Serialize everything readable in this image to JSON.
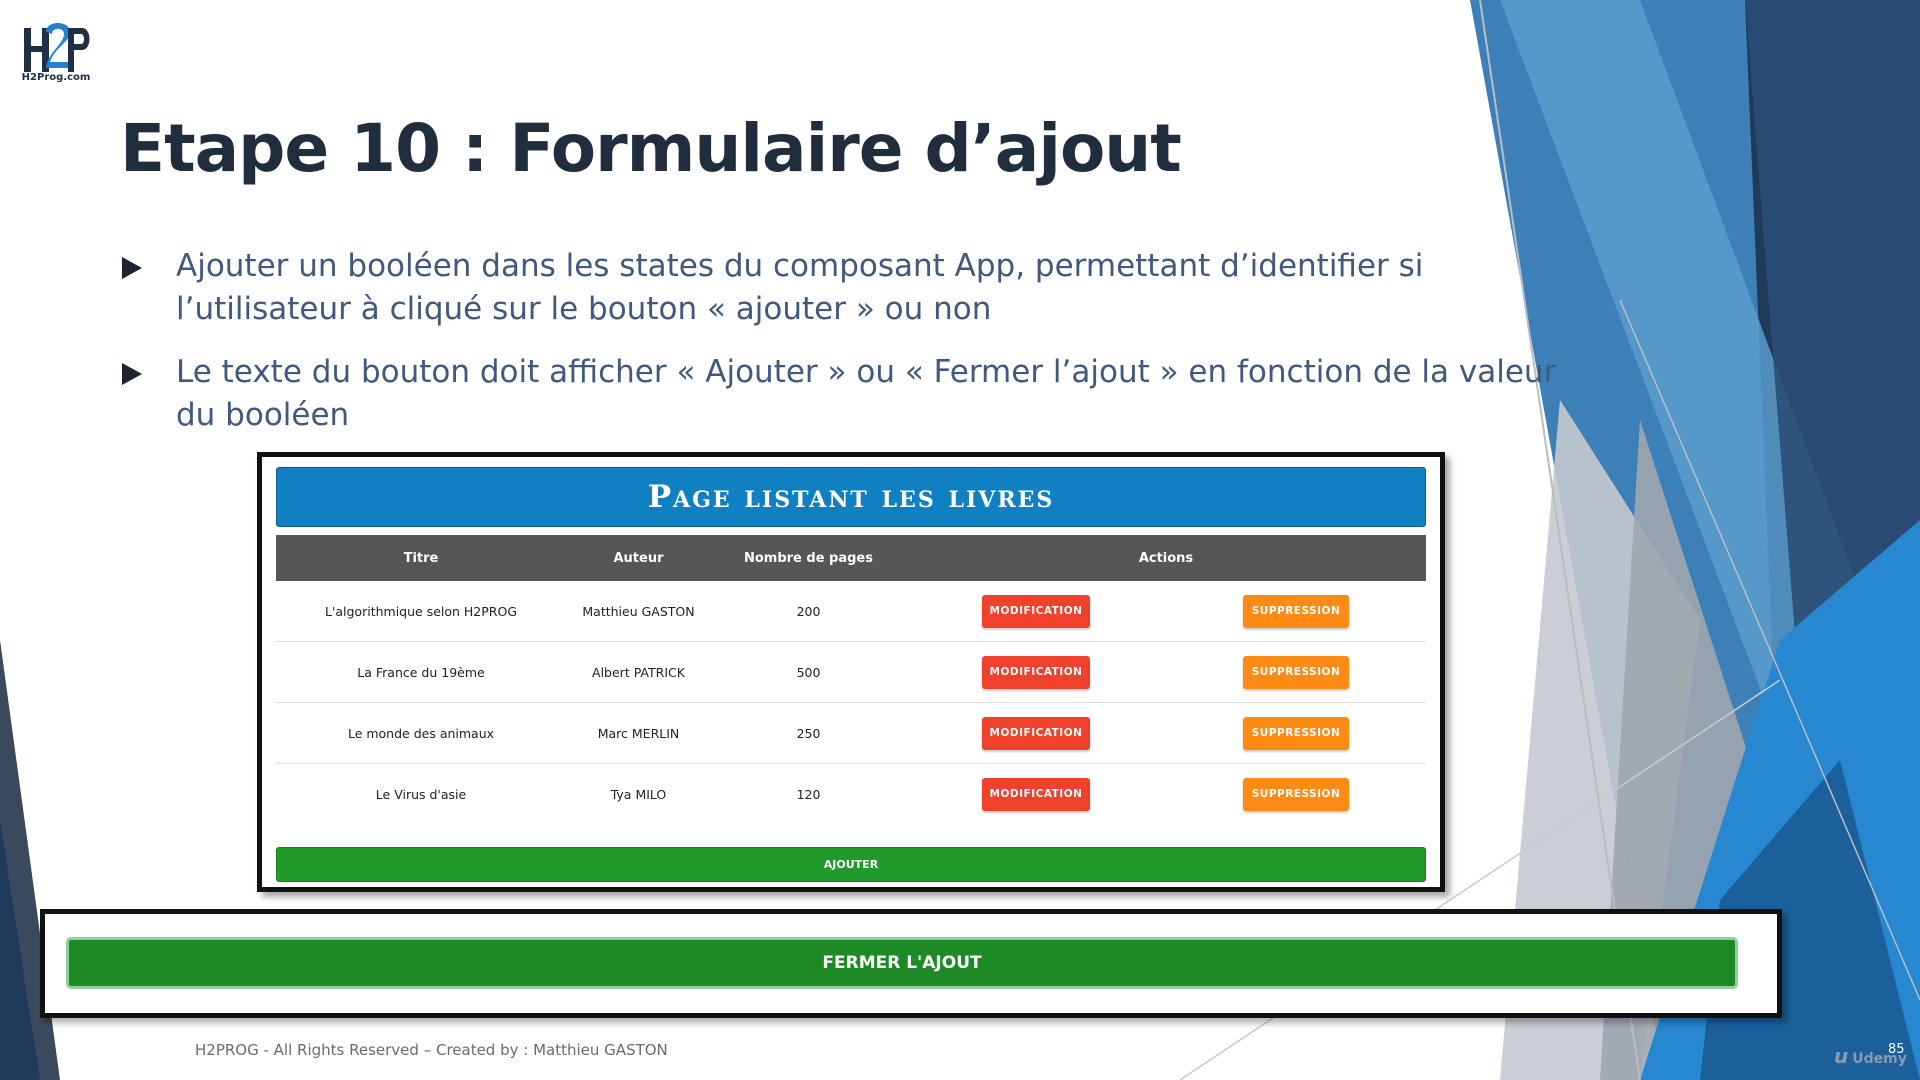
{
  "logo": {
    "mark": "H2P",
    "url_text": "H2Prog.com"
  },
  "slide": {
    "title": "Etape 10 : Formulaire d’ajout",
    "bullets": [
      "Ajouter un booléen dans les states du composant App, permettant d’identifier si l’utilisateur à cliqué sur le bouton « ajouter » ou non",
      "Le texte du bouton doit afficher « Ajouter » ou « Fermer l’ajout » en fonction de la valeur du booléen"
    ]
  },
  "app": {
    "title": "Page listant les livres",
    "columns": [
      "Titre",
      "Auteur",
      "Nombre de pages",
      "Actions"
    ],
    "rows": [
      {
        "titre": "L'algorithmique selon H2PROG",
        "auteur": "Matthieu GASTON",
        "pages": "200"
      },
      {
        "titre": "La France du 19ème",
        "auteur": "Albert PATRICK",
        "pages": "500"
      },
      {
        "titre": "Le monde des animaux",
        "auteur": "Marc MERLIN",
        "pages": "250"
      },
      {
        "titre": "Le Virus d'asie",
        "auteur": "Tya MILO",
        "pages": "120"
      }
    ],
    "modify_label": "MODIFICATION",
    "delete_label": "SUPPRESSION",
    "add_label": "AJOUTER"
  },
  "close_button": {
    "label": "FERMER L'AJOUT"
  },
  "footer": {
    "copyright": "H2PROG - All Rights Reserved – Created by : Matthieu GASTON",
    "page_number": "85",
    "watermark": "Udemy"
  },
  "colors": {
    "header_blue": "#1080c2",
    "modify_red": "#f0412c",
    "delete_orange": "#ff8a14",
    "add_green": "#1f9a2b",
    "close_green": "#1d8a25",
    "title_dark": "#1f2d3d",
    "bullet_text": "#3f5a7e"
  }
}
